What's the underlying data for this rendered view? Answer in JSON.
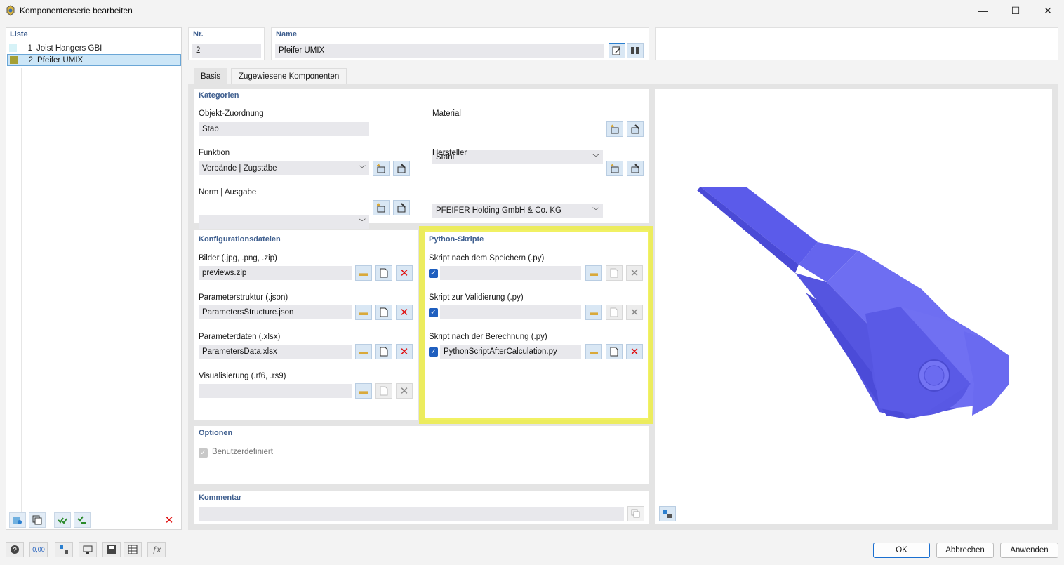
{
  "window": {
    "title": "Komponentenserie bearbeiten",
    "minimize": "—",
    "maximize": "☐",
    "close": "✕"
  },
  "list": {
    "header": "Liste",
    "items": [
      {
        "num": "1",
        "label": "Joist Hangers GBI",
        "color": "#d6f2f7"
      },
      {
        "num": "2",
        "label": "Pfeifer UMIX",
        "color": "#a5a035"
      }
    ]
  },
  "header": {
    "nr_label": "Nr.",
    "nr_value": "2",
    "name_label": "Name",
    "name_value": "Pfeifer UMIX"
  },
  "tabs": [
    {
      "label": "Basis",
      "active": true
    },
    {
      "label": "Zugewiesene Komponenten",
      "active": false
    }
  ],
  "kategorien": {
    "title": "Kategorien",
    "objekt_label": "Objekt-Zuordnung",
    "objekt_value": "Stab",
    "funktion_label": "Funktion",
    "funktion_value": "Verbände | Zugstäbe",
    "norm_label": "Norm | Ausgabe",
    "norm_value": "",
    "material_label": "Material",
    "material_value": "Stahl",
    "hersteller_label": "Hersteller",
    "hersteller_value": "PFEIFER Holding GmbH & Co. KG"
  },
  "konfig": {
    "title": "Konfigurationsdateien",
    "bilder_label": "Bilder (.jpg, .png, .zip)",
    "bilder_value": "previews.zip",
    "struktur_label": "Parameterstruktur (.json)",
    "struktur_value": "ParametersStructure.json",
    "daten_label": "Parameterdaten (.xlsx)",
    "daten_value": "ParametersData.xlsx",
    "vis_label": "Visualisierung (.rf6, .rs9)",
    "vis_value": ""
  },
  "python": {
    "title": "Python-Skripte",
    "speichern_label": "Skript nach dem Speichern (.py)",
    "speichern_value": "",
    "validierung_label": "Skript zur Validierung (.py)",
    "validierung_value": "",
    "berechnung_label": "Skript nach der Berechnung (.py)",
    "berechnung_value": "PythonScriptAfterCalculation.py"
  },
  "optionen": {
    "title": "Optionen",
    "benutzer_label": "Benutzerdefiniert"
  },
  "kommentar": {
    "title": "Kommentar",
    "value": ""
  },
  "footer": {
    "ok": "OK",
    "abbrechen": "Abbrechen",
    "anwenden": "Anwenden",
    "units_icon_text": "0,00"
  },
  "colors": {
    "accent_blue": "#3f5f8f",
    "highlight": "#eeee3c",
    "model": "#6f6ff0"
  }
}
